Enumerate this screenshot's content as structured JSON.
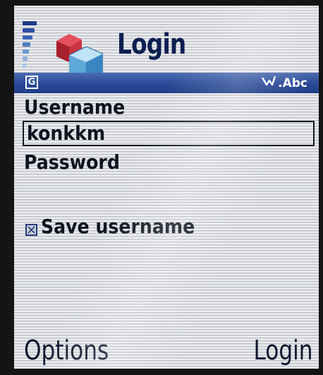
{
  "header": {
    "title": "Login",
    "app_icon": "login-cubes-icon",
    "signal_icon": "signal-strength-icon"
  },
  "status_bar": {
    "network_indicator": "G",
    "input_mode_icon": "pen-icon",
    "input_mode": ".Abc"
  },
  "form": {
    "username_label": "Username",
    "username_value": "konkkm",
    "password_label": "Password",
    "save_username_label": "Save username",
    "save_username_checked": true
  },
  "softkeys": {
    "left": "Options",
    "right": "Login"
  },
  "colors": {
    "title": "#0b1f50",
    "status_bar": "#2a4a98",
    "text": "#0f1420"
  }
}
